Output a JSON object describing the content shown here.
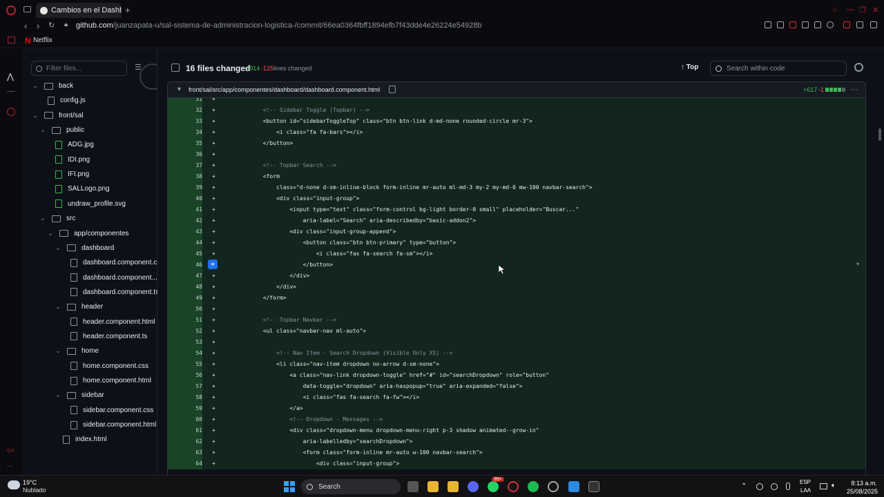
{
  "browser": {
    "tab_title": "Cambios en el Dashboard.",
    "url_host": "github.com",
    "url_path": "/juanzapata-u/sal-sistema-de-administracion-logistica-/commit/66ea0364fbff1894efb7f43dde4e26224e54928b",
    "bookmark": "Netflix"
  },
  "tree": {
    "filter_placeholder": "Filter files...",
    "rows": [
      {
        "label": "back",
        "type": "folder"
      },
      {
        "label": "config.js",
        "type": "file"
      },
      {
        "label": "front/sal",
        "type": "folder"
      },
      {
        "label": "public",
        "type": "folder"
      },
      {
        "label": "ADG.jpg",
        "type": "added"
      },
      {
        "label": "IDI.png",
        "type": "added"
      },
      {
        "label": "IFI.png",
        "type": "added"
      },
      {
        "label": "SALLogo.png",
        "type": "added"
      },
      {
        "label": "undraw_profile.svg",
        "type": "added"
      },
      {
        "label": "src",
        "type": "folder"
      },
      {
        "label": "app/componentes",
        "type": "folder"
      },
      {
        "label": "dashboard",
        "type": "folder"
      },
      {
        "label": "dashboard.component.c...",
        "type": "file"
      },
      {
        "label": "dashboard.component....",
        "type": "file"
      },
      {
        "label": "dashboard.component.ts",
        "type": "file"
      },
      {
        "label": "header",
        "type": "folder"
      },
      {
        "label": "header.component.html",
        "type": "file"
      },
      {
        "label": "header.component.ts",
        "type": "file"
      },
      {
        "label": "home",
        "type": "folder"
      },
      {
        "label": "home.component.css",
        "type": "file"
      },
      {
        "label": "home.component.html",
        "type": "file"
      },
      {
        "label": "sidebar",
        "type": "folder"
      },
      {
        "label": "sidebar.component.css",
        "type": "file"
      },
      {
        "label": "sidebar.component.html",
        "type": "file"
      },
      {
        "label": "index.html",
        "type": "file"
      }
    ]
  },
  "diff": {
    "files_changed": "16 files changed",
    "additions": "+914",
    "deletions": "-125",
    "lines_changed": "lines changed",
    "top_label": "Top",
    "search_placeholder": "Search within code",
    "file_path": "front/sal/src/app/componentes/dashboard/dashboard.component.html",
    "file_additions": "+617",
    "file_deletions": "-1"
  },
  "code_lines": [
    {
      "n": "31",
      "t": ""
    },
    {
      "n": "32",
      "t": "            <!-- Sidebar Toggle (Topbar) -->"
    },
    {
      "n": "33",
      "t": "            <button id=\"sidebarToggleTop\" class=\"btn btn-link d-md-none rounded-circle mr-3\">"
    },
    {
      "n": "34",
      "t": "                <i class=\"fa fa-bars\"></i>"
    },
    {
      "n": "35",
      "t": "            </button>"
    },
    {
      "n": "36",
      "t": ""
    },
    {
      "n": "37",
      "t": "            <!-- Topbar Search -->"
    },
    {
      "n": "38",
      "t": "            <form"
    },
    {
      "n": "39",
      "t": "                class=\"d-none d-sm-inline-block form-inline mr-auto ml-md-3 my-2 my-md-0 mw-100 navbar-search\">"
    },
    {
      "n": "40",
      "t": "                <div class=\"input-group\">"
    },
    {
      "n": "41",
      "t": "                    <input type=\"text\" class=\"form-control bg-light border-0 small\" placeholder=\"Buscar...\""
    },
    {
      "n": "42",
      "t": "                        aria-label=\"Search\" aria-describedby=\"basic-addon2\">"
    },
    {
      "n": "43",
      "t": "                    <div class=\"input-group-append\">"
    },
    {
      "n": "44",
      "t": "                        <button class=\"btn btn-primary\" type=\"button\">"
    },
    {
      "n": "45",
      "t": "                            <i class=\"fas fa-search fa-sm\"></i>"
    },
    {
      "n": "46",
      "t": "                        </button>"
    },
    {
      "n": "47",
      "t": "                    </div>"
    },
    {
      "n": "48",
      "t": "                </div>"
    },
    {
      "n": "49",
      "t": "            </form>"
    },
    {
      "n": "50",
      "t": ""
    },
    {
      "n": "51",
      "t": "            <!-- Topbar Navbar -->"
    },
    {
      "n": "52",
      "t": "            <ul class=\"navbar-nav ml-auto\">"
    },
    {
      "n": "53",
      "t": ""
    },
    {
      "n": "54",
      "t": "                <!-- Nav Item - Search Dropdown (Visible Only XS) -->"
    },
    {
      "n": "55",
      "t": "                <li class=\"nav-item dropdown no-arrow d-sm-none\">"
    },
    {
      "n": "56",
      "t": "                    <a class=\"nav-link dropdown-toggle\" href=\"#\" id=\"searchDropdown\" role=\"button\""
    },
    {
      "n": "57",
      "t": "                        data-toggle=\"dropdown\" aria-haspopup=\"true\" aria-expanded=\"false\">"
    },
    {
      "n": "58",
      "t": "                        <i class=\"fas fa-search fa-fw\"></i>"
    },
    {
      "n": "59",
      "t": "                    </a>"
    },
    {
      "n": "60",
      "t": "                    <!-- Dropdown - Messages -->"
    },
    {
      "n": "61",
      "t": "                    <div class=\"dropdown-menu dropdown-menu-right p-3 shadow animated--grow-in\""
    },
    {
      "n": "62",
      "t": "                        aria-labelledby=\"searchDropdown\">"
    },
    {
      "n": "63",
      "t": "                        <form class=\"form-inline mr-auto w-100 navbar-search\">"
    },
    {
      "n": "64",
      "t": "                            <div class=\"input-group\">"
    }
  ],
  "taskbar": {
    "temp": "19°C",
    "weather": "Nublado",
    "search": "Search",
    "badge": "99+",
    "lang_1": "ESP",
    "lang_2": "LAA",
    "time": "8:13 a.m.",
    "date": "25/08/2025"
  }
}
